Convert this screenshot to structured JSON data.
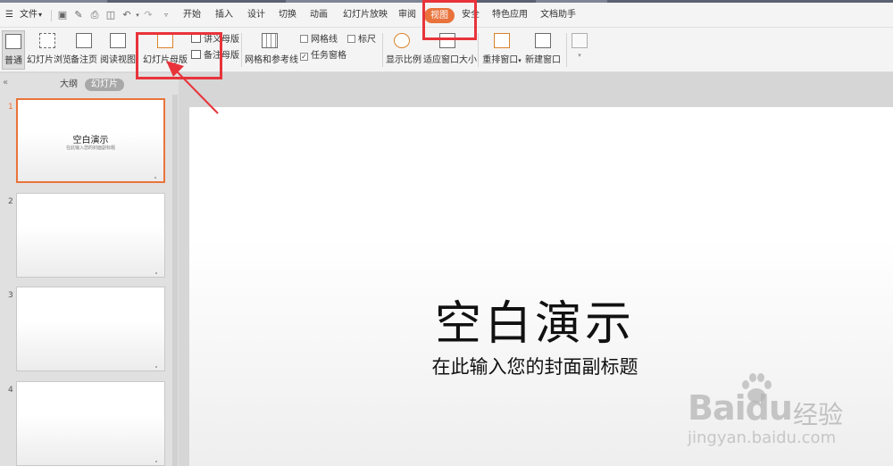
{
  "menubar": {
    "file": "文件",
    "tabs": [
      "开始",
      "插入",
      "设计",
      "切换",
      "动画",
      "幻灯片放映",
      "审阅",
      "视图",
      "安全",
      "特色应用",
      "文档助手"
    ],
    "active_tab": "视图"
  },
  "ribbon": {
    "normal": "普通",
    "slide_sorter": "幻灯片浏览",
    "notes_page": "备注页",
    "reading_view": "阅读视图",
    "slide_master": "幻灯片母版",
    "handout_master": "讲义母版",
    "notes_master": "备注母版",
    "grid_guides": "网格和参考线",
    "gridlines": "网格线",
    "ruler": "标尺",
    "task_pane": "任务窗格",
    "zoom": "显示比例",
    "fit_window": "适应窗口大小",
    "arrange_window": "重排窗口",
    "new_window": "新建窗口"
  },
  "panel": {
    "tab_outline": "大纲",
    "tab_slides": "幻灯片",
    "slides": [
      {
        "num": "1",
        "title": "空白演示",
        "subtitle": "在此输入您的封面副标题"
      },
      {
        "num": "2"
      },
      {
        "num": "3"
      },
      {
        "num": "4"
      }
    ]
  },
  "slide": {
    "title": "空白演示",
    "subtitle": "在此输入您的封面副标题"
  },
  "watermark": {
    "logo": "Baidu",
    "cn": "经验",
    "url": "jingyan.baidu.com"
  },
  "colors": {
    "accent": "#e9733b",
    "annotation": "#e8333a"
  }
}
